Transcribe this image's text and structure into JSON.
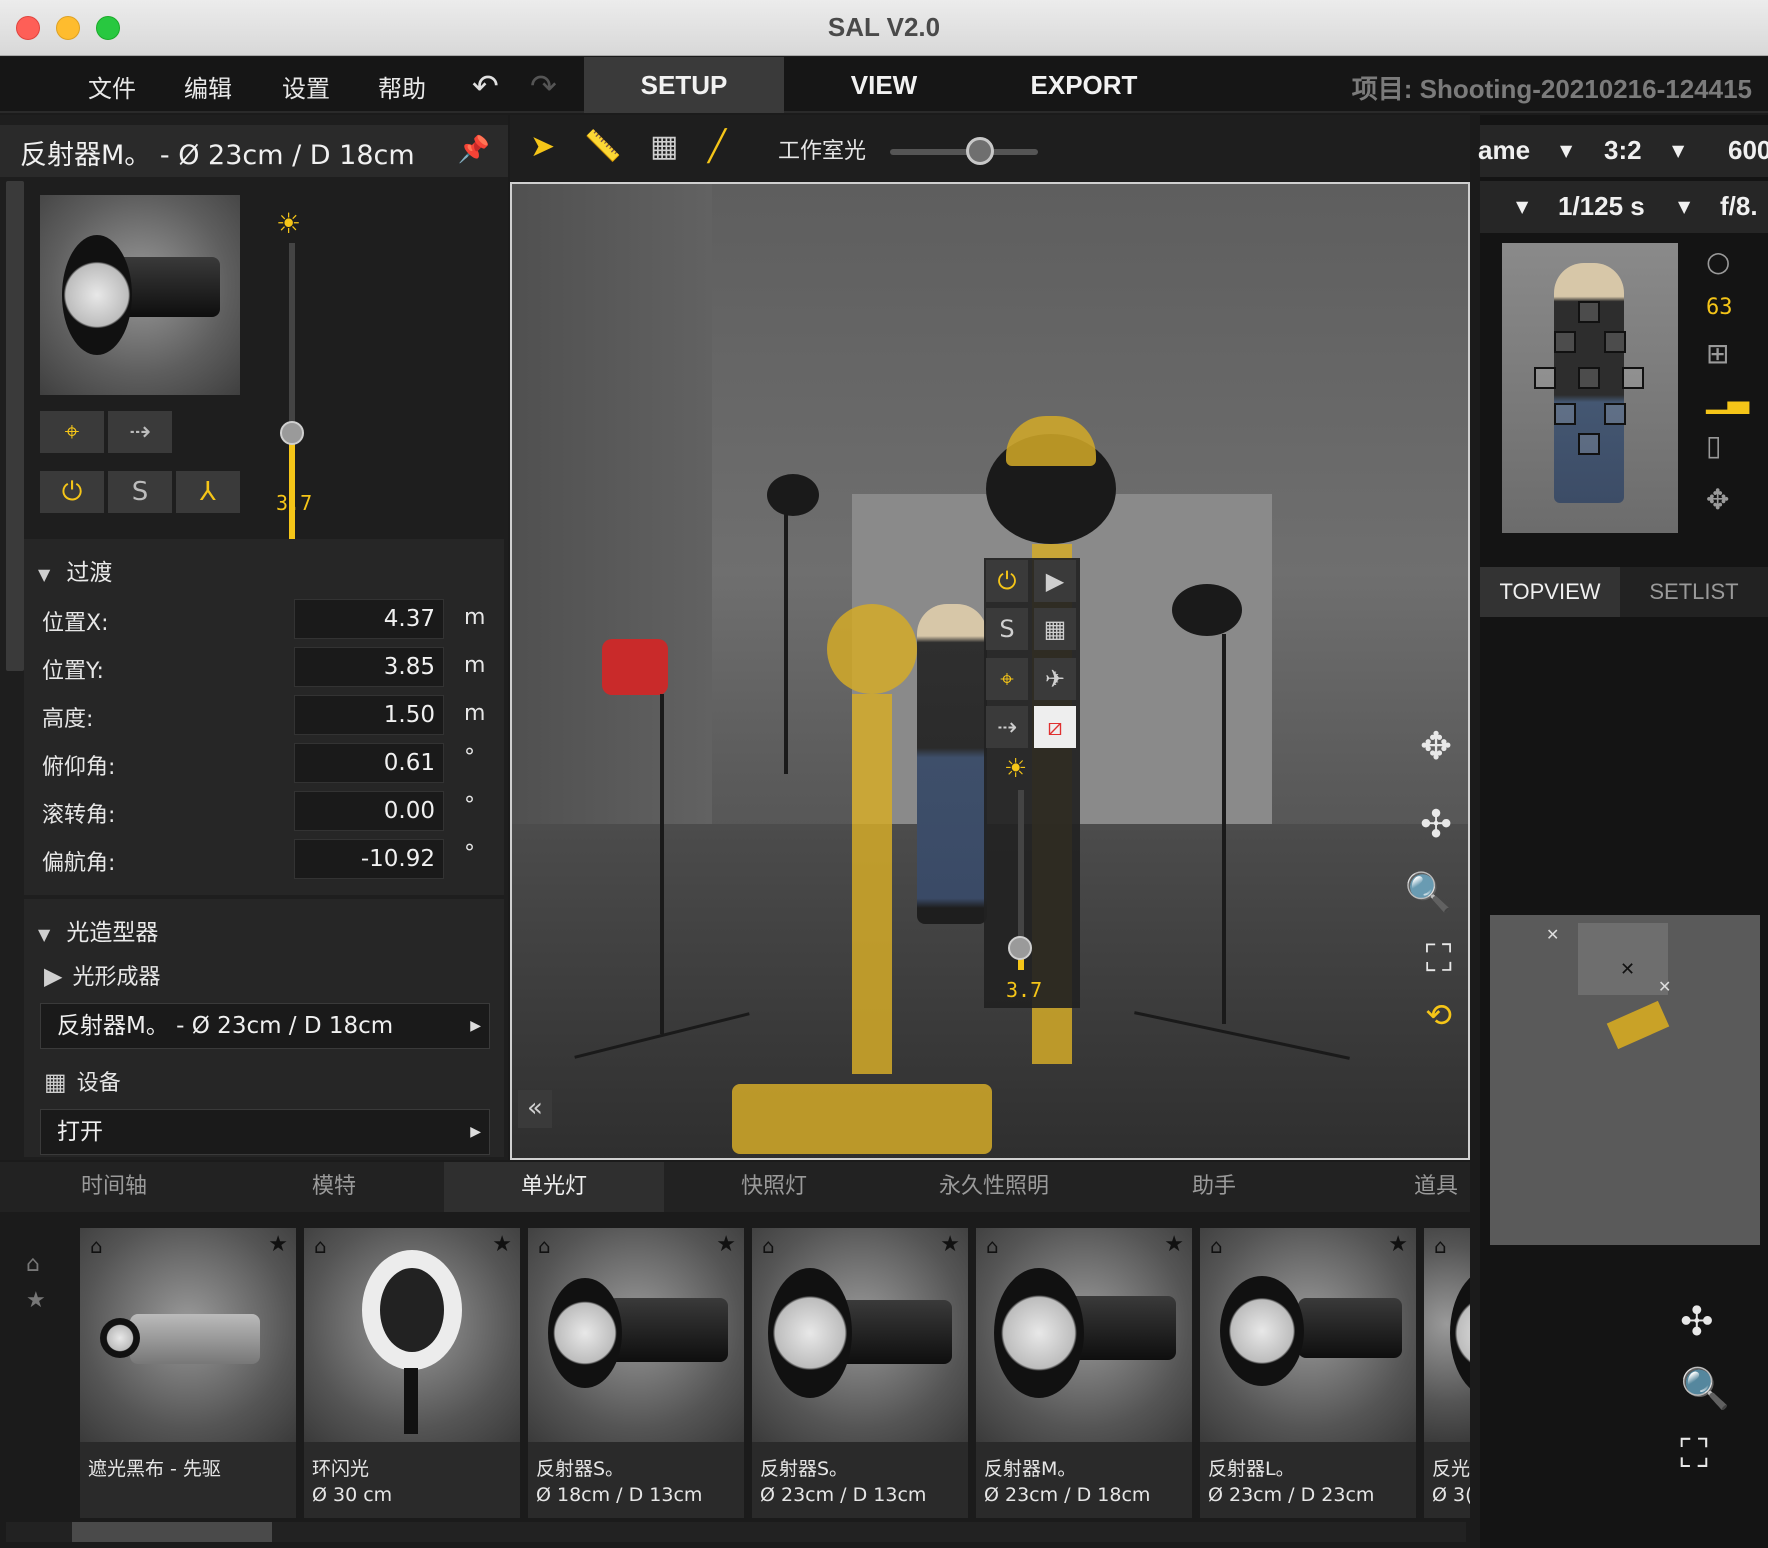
{
  "window": {
    "title": "SAL V2.0"
  },
  "menu": {
    "items": [
      "文件",
      "编辑",
      "设置",
      "帮助"
    ],
    "modes": [
      {
        "label": "SETUP",
        "active": true
      },
      {
        "label": "VIEW",
        "active": false
      },
      {
        "label": "EXPORT",
        "active": false
      }
    ],
    "project": "项目: Shooting-20210216-124415"
  },
  "left": {
    "title": "反射器M。 - Ø 23cm / D 18cm",
    "light_level": "3.7",
    "buttons": [
      "target-icon",
      "walk-icon",
      "power-icon",
      "S",
      "stand-icon"
    ],
    "transform": {
      "header": "过渡",
      "rows": [
        {
          "label": "位置X:",
          "value": "4.37",
          "unit": "m"
        },
        {
          "label": "位置Y:",
          "value": "3.85",
          "unit": "m"
        },
        {
          "label": "高度:",
          "value": "1.50",
          "unit": "m"
        },
        {
          "label": "俯仰角:",
          "value": "0.61",
          "unit": "°"
        },
        {
          "label": "滚转角:",
          "value": "0.00",
          "unit": "°"
        },
        {
          "label": "偏航角:",
          "value": "-10.92",
          "unit": "°"
        }
      ]
    },
    "modifier": {
      "header": "光造型器",
      "shaper_label": "光形成器",
      "shaper_value": "反射器M。 - Ø 23cm / D 18cm",
      "device_label": "设备",
      "device_value": "打开"
    }
  },
  "viewport_toolbar": {
    "studio_light_label": "工作室光",
    "studio_light_level": 0.5
  },
  "viewport": {
    "float_level": "3.7"
  },
  "right": {
    "row1": {
      "name": "ame",
      "ratio": "3:2",
      "value": "600"
    },
    "row2": {
      "shutter": "1/125 s",
      "aperture": "f/8."
    },
    "meter": "63",
    "tabs": [
      {
        "label": "TOPVIEW",
        "active": true
      },
      {
        "label": "SETLIST",
        "active": false
      }
    ]
  },
  "library": {
    "tabs": [
      {
        "label": "时间轴",
        "active": false
      },
      {
        "label": "模特",
        "active": false
      },
      {
        "label": "单光灯",
        "active": true
      },
      {
        "label": "快照灯",
        "active": false
      },
      {
        "label": "永久性照明",
        "active": false
      },
      {
        "label": "助手",
        "active": false
      },
      {
        "label": "道具",
        "active": false
      }
    ],
    "cards": [
      {
        "line1": "遮光黑布 - 先驱",
        "line2": ""
      },
      {
        "line1": "环闪光",
        "line2": "Ø 30 cm"
      },
      {
        "line1": "反射器S。",
        "line2": "Ø 18cm / D 13cm"
      },
      {
        "line1": "反射器S。",
        "line2": "Ø 23cm / D 13cm"
      },
      {
        "line1": "反射器M。",
        "line2": "Ø 23cm / D 18cm"
      },
      {
        "line1": "反射器L。",
        "line2": "Ø 23cm / D 23cm"
      },
      {
        "line1": "反光",
        "line2": "Ø 3("
      }
    ]
  },
  "colors": {
    "accent": "#f5c518",
    "panel": "#1e1e1e",
    "active_tab": "#3a3a3a"
  }
}
